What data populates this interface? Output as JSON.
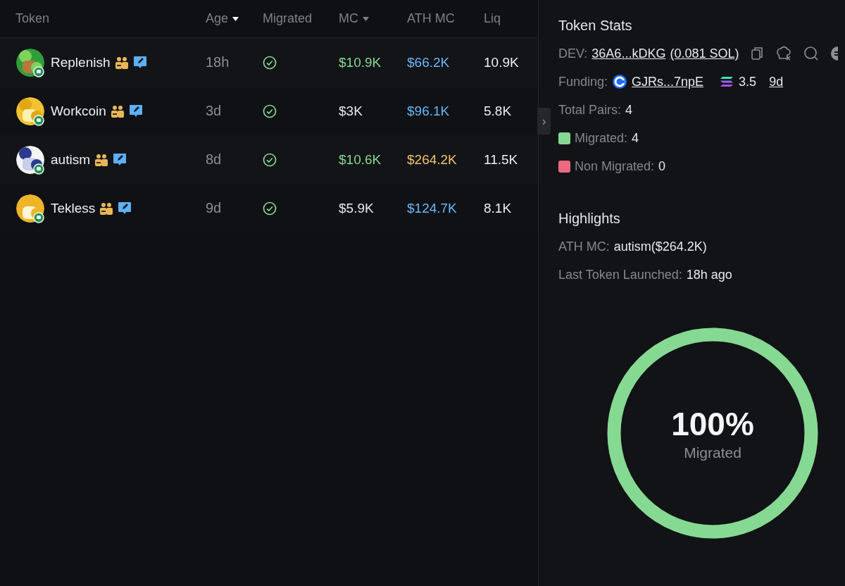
{
  "table": {
    "columns": [
      {
        "label": "Token",
        "sortable": false
      },
      {
        "label": "Age",
        "sortable": true,
        "active": true
      },
      {
        "label": "Migrated",
        "sortable": false
      },
      {
        "label": "MC",
        "sortable": true,
        "active": false
      },
      {
        "label": "ATH MC",
        "sortable": false
      },
      {
        "label": "Liq",
        "sortable": false
      }
    ],
    "rows": [
      {
        "name": "Replenish",
        "age": "18h",
        "migrated": true,
        "mc": {
          "text": "$10.9K",
          "color": "#86d993"
        },
        "ath_mc": {
          "text": "$66.2K",
          "color": "#6ab8f7"
        },
        "liq": "10.9K"
      },
      {
        "name": "Workcoin",
        "age": "3d",
        "migrated": true,
        "mc": {
          "text": "$3K",
          "color": "#e8e8ea"
        },
        "ath_mc": {
          "text": "$96.1K",
          "color": "#6ab8f7"
        },
        "liq": "5.8K"
      },
      {
        "name": "autism",
        "age": "8d",
        "migrated": true,
        "mc": {
          "text": "$10.6K",
          "color": "#86d993"
        },
        "ath_mc": {
          "text": "$264.2K",
          "color": "#f2c46b"
        },
        "liq": "11.5K"
      },
      {
        "name": "Tekless",
        "age": "9d",
        "migrated": true,
        "mc": {
          "text": "$5.9K",
          "color": "#e8e8ea"
        },
        "ath_mc": {
          "text": "$124.7K",
          "color": "#6ab8f7"
        },
        "liq": "8.1K"
      }
    ]
  },
  "panel_toggle": {
    "label": "›"
  },
  "token_stats": {
    "title": "Token Stats",
    "dev": {
      "label": "DEV:",
      "address": "36A6...kDKG",
      "balance": "(0.081 SOL)"
    },
    "funding": {
      "label": "Funding:",
      "address": "GJRs...7npE",
      "amount": "3.5",
      "age": "9d"
    },
    "total_pairs": {
      "label": "Total Pairs:",
      "value": "4"
    },
    "legend": [
      {
        "label": "Migrated:",
        "value": "4",
        "color": "#86d993"
      },
      {
        "label": "Non Migrated:",
        "value": "0",
        "color": "#ec6a80"
      }
    ]
  },
  "highlights": {
    "title": "Highlights",
    "items": [
      {
        "label": "ATH MC:",
        "value": "autism($264.2K)"
      },
      {
        "label": "Last Token Launched:",
        "value": "18h ago"
      }
    ]
  },
  "ring": {
    "level": 1,
    "percent": "100%",
    "label": "Migrated"
  }
}
